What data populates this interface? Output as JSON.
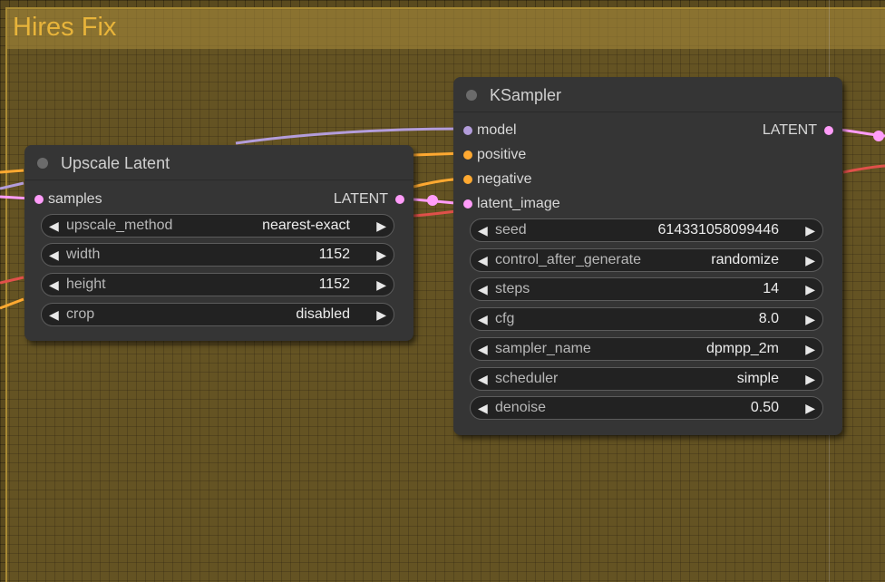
{
  "group": {
    "title": "Hires Fix"
  },
  "colors": {
    "model": "#b39ddb",
    "conditioning": "#ffa931",
    "latent": "#ff9cf9",
    "red_wire": "#e0504a",
    "group_title": "#e8b43a"
  },
  "nodes": {
    "upscale": {
      "title": "Upscale Latent",
      "input": "samples",
      "output": "LATENT",
      "widgets": [
        {
          "label": "upscale_method",
          "value": "nearest-exact"
        },
        {
          "label": "width",
          "value": "1152"
        },
        {
          "label": "height",
          "value": "1152"
        },
        {
          "label": "crop",
          "value": "disabled"
        }
      ]
    },
    "ksampler": {
      "title": "KSampler",
      "inputs": [
        "model",
        "positive",
        "negative",
        "latent_image"
      ],
      "output": "LATENT",
      "widgets": [
        {
          "label": "seed",
          "value": "614331058099446"
        },
        {
          "label": "control_after_generate",
          "value": "randomize"
        },
        {
          "label": "steps",
          "value": "14"
        },
        {
          "label": "cfg",
          "value": "8.0"
        },
        {
          "label": "sampler_name",
          "value": "dpmpp_2m"
        },
        {
          "label": "scheduler",
          "value": "simple"
        },
        {
          "label": "denoise",
          "value": "0.50"
        }
      ]
    }
  },
  "icons": {
    "left_arrow": "◀",
    "right_arrow": "▶"
  }
}
